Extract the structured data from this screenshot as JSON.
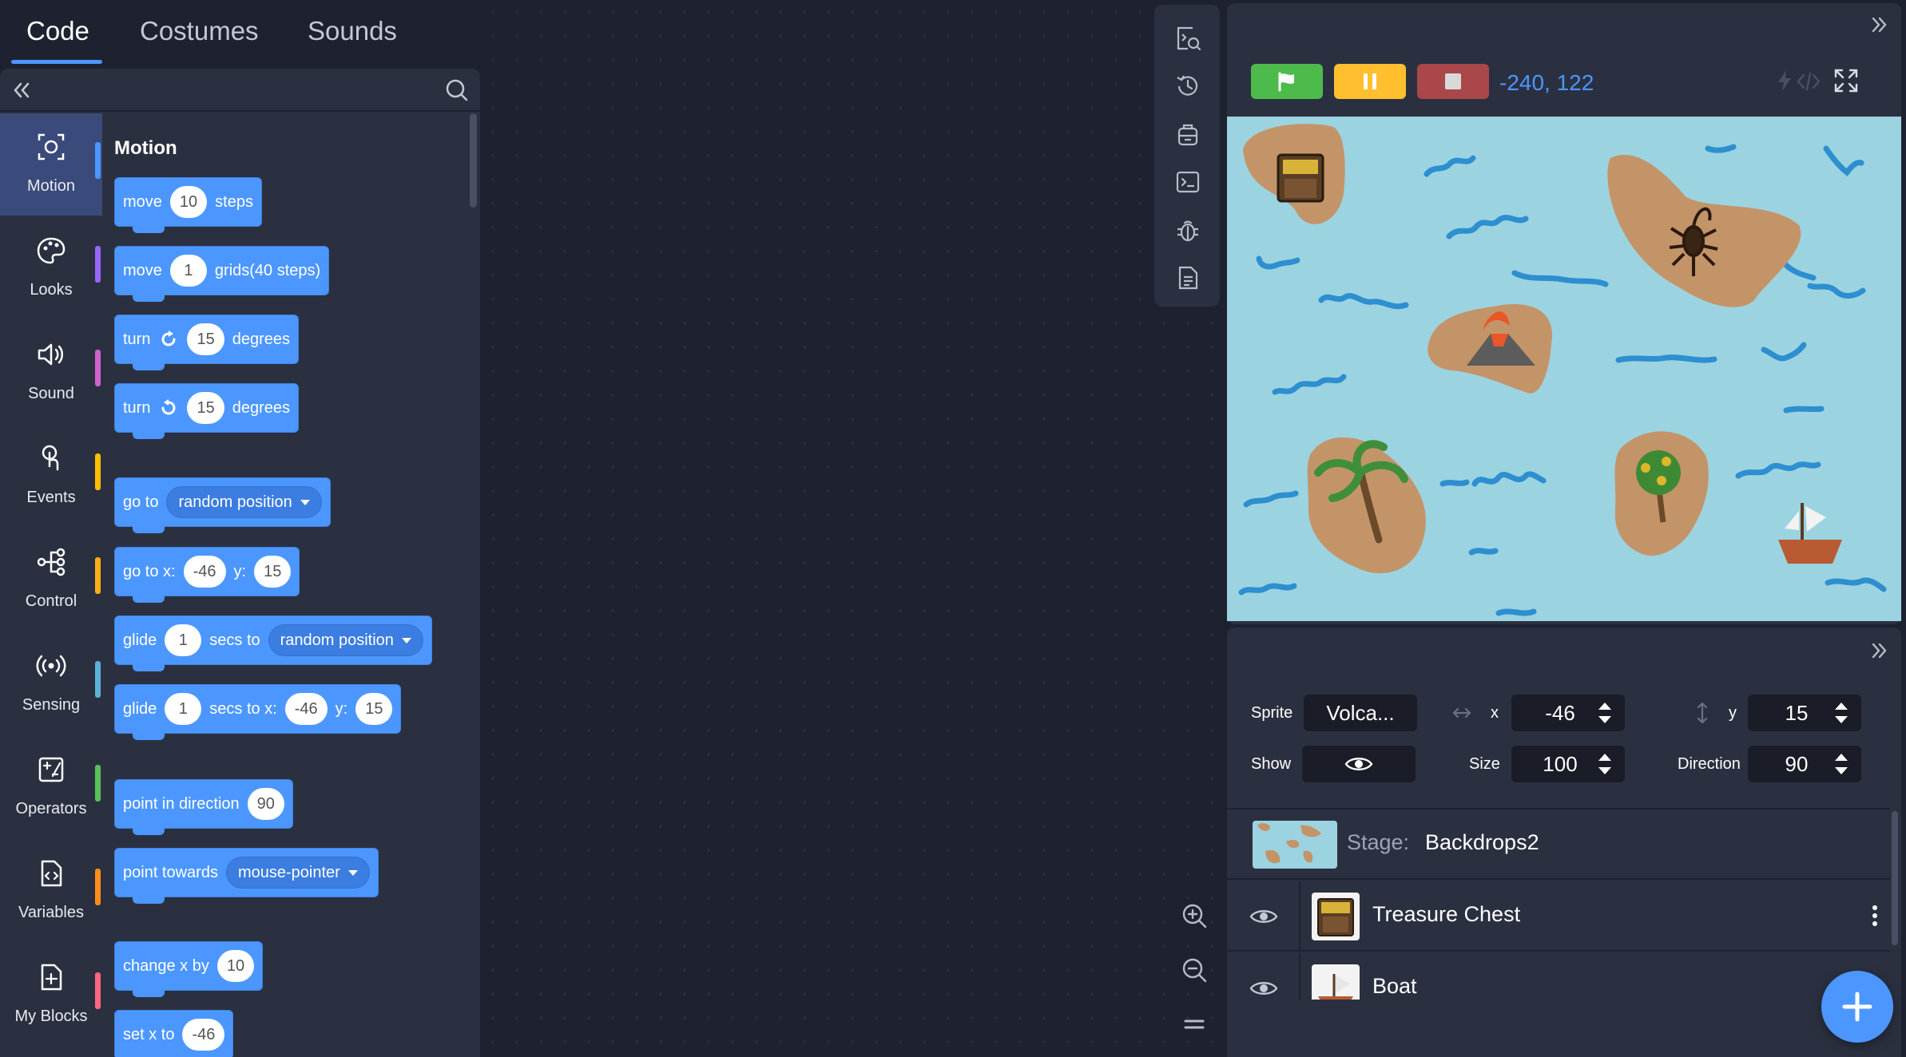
{
  "tabs": {
    "code": "Code",
    "costumes": "Costumes",
    "sounds": "Sounds"
  },
  "categories": [
    {
      "label": "Motion",
      "color": "#4c97ff"
    },
    {
      "label": "Looks",
      "color": "#9966ff"
    },
    {
      "label": "Sound",
      "color": "#cf63cf"
    },
    {
      "label": "Events",
      "color": "#ffbf00"
    },
    {
      "label": "Control",
      "color": "#ffab19"
    },
    {
      "label": "Sensing",
      "color": "#5cb1d6"
    },
    {
      "label": "Operators",
      "color": "#59c059"
    },
    {
      "label": "Variables",
      "color": "#ff8c1a"
    },
    {
      "label": "My Blocks",
      "color": "#ff6680"
    }
  ],
  "section_title": "Motion",
  "blocks": {
    "b1": {
      "t1": "move",
      "v1": "10",
      "t2": "steps"
    },
    "b2": {
      "t1": "move",
      "v1": "1",
      "t2": "grids(40 steps)"
    },
    "b3": {
      "t1": "turn",
      "v1": "15",
      "t2": "degrees"
    },
    "b4": {
      "t1": "turn",
      "v1": "15",
      "t2": "degrees"
    },
    "b5": {
      "t1": "go to",
      "d1": "random position"
    },
    "b6": {
      "t1": "go to x:",
      "v1": "-46",
      "t2": "y:",
      "v2": "15"
    },
    "b7": {
      "t1": "glide",
      "v1": "1",
      "t2": "secs to",
      "d1": "random position"
    },
    "b8": {
      "t1": "glide",
      "v1": "1",
      "t2": "secs to x:",
      "v2": "-46",
      "t3": "y:",
      "v3": "15"
    },
    "b9": {
      "t1": "point in direction",
      "v1": "90"
    },
    "b10": {
      "t1": "point towards",
      "d1": "mouse-pointer"
    },
    "b11": {
      "t1": "change x by",
      "v1": "10"
    },
    "b12": {
      "t1": "set x to",
      "v1": "-46"
    }
  },
  "stage": {
    "coords": "-240,  122"
  },
  "sprite_panel": {
    "sprite_label": "Sprite",
    "sprite_name": "Volca...",
    "x_label": "x",
    "x_value": "-46",
    "y_label": "y",
    "y_value": "15",
    "show_label": "Show",
    "size_label": "Size",
    "size_value": "100",
    "direction_label": "Direction",
    "direction_value": "90",
    "stage_prefix": "Stage:",
    "stage_name": "Backdrops2",
    "sprites": [
      "Treasure Chest",
      "Boat"
    ]
  },
  "colors": {
    "accent": "#4c97ff",
    "panel": "#2b3040",
    "background": "#1e2230",
    "flag": "#4cbb4c",
    "pause": "#ffbf2e",
    "stop": "#c0464a"
  }
}
